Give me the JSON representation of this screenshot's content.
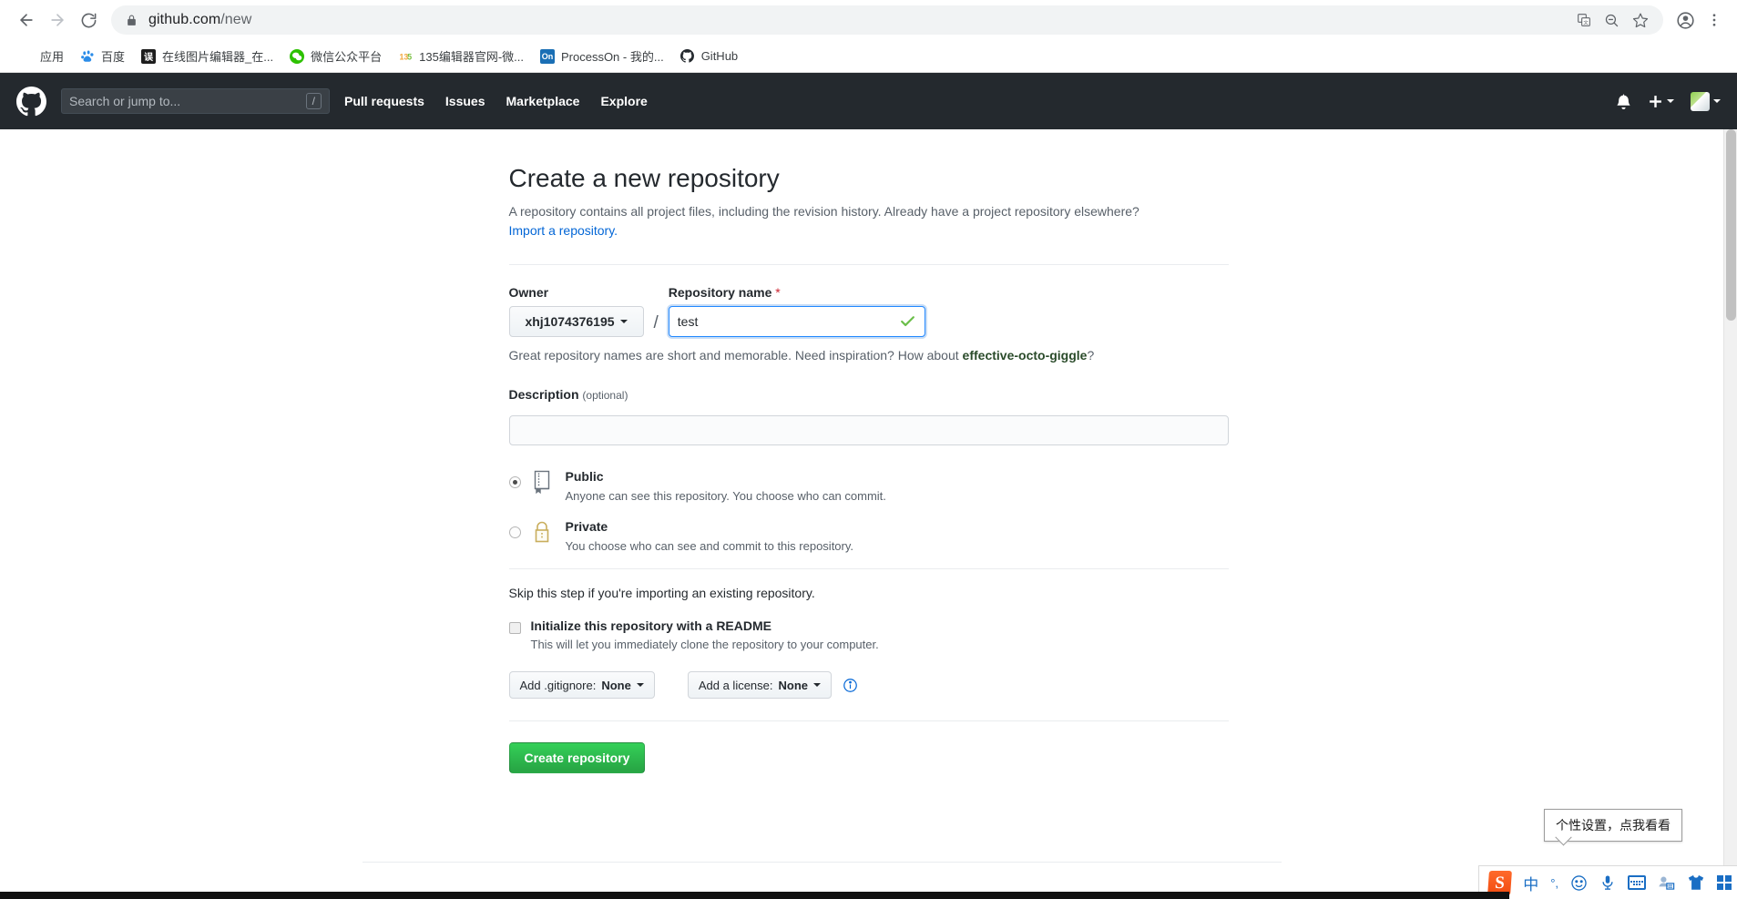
{
  "browser": {
    "back_label": "Back",
    "forward_label": "Forward",
    "reload_label": "Reload",
    "url_host": "github.com",
    "url_path": "/new",
    "lock_icon": "lock-icon",
    "translate_icon": "translate-icon",
    "zoom_out_icon": "zoom-out-icon",
    "bookmark_star_icon": "star-icon",
    "profile_icon": "profile-avatar-icon",
    "menu_icon": "three-dot-menu-icon",
    "bookmarks": [
      {
        "label": "应用",
        "icon": "apps-grid-icon"
      },
      {
        "label": "百度",
        "icon": "baidu-icon"
      },
      {
        "label": "在线图片编辑器_在...",
        "icon": "image-editor-icon"
      },
      {
        "label": "微信公众平台",
        "icon": "wechat-icon"
      },
      {
        "label": "135编辑器官网-微...",
        "icon": "135-editor-icon"
      },
      {
        "label": "ProcessOn - 我的...",
        "icon": "processon-icon",
        "badge": "On"
      },
      {
        "label": "GitHub",
        "icon": "github-icon"
      }
    ]
  },
  "gh_header": {
    "logo_icon": "github-mark-icon",
    "search_placeholder": "Search or jump to...",
    "search_shortcut": "/",
    "nav": [
      {
        "label": "Pull requests"
      },
      {
        "label": "Issues"
      },
      {
        "label": "Marketplace"
      },
      {
        "label": "Explore"
      }
    ],
    "notifications_icon": "bell-icon",
    "create_new_icon": "plus-icon",
    "avatar_icon": "user-avatar-icon",
    "bg_color": "#24292e"
  },
  "main": {
    "title": "Create a new repository",
    "subtitle": "A repository contains all project files, including the revision history. Already have a project repository elsewhere?",
    "import_link": "Import a repository.",
    "owner": {
      "label": "Owner",
      "value": "xhj1074376195"
    },
    "repo_name": {
      "label": "Repository name",
      "required_marker": "*",
      "value": "test",
      "valid_icon": "green-check-icon"
    },
    "separator": "/",
    "hint_prefix": "Great repository names are short and memorable. Need inspiration? How about ",
    "hint_suggestion": "effective-octo-giggle",
    "hint_suffix": "?",
    "description": {
      "label": "Description",
      "optional_label": "(optional)",
      "value": "",
      "placeholder": ""
    },
    "visibility": [
      {
        "id": "public",
        "title": "Public",
        "desc": "Anyone can see this repository. You choose who can commit.",
        "icon": "repo-book-icon",
        "selected": true
      },
      {
        "id": "private",
        "title": "Private",
        "desc": "You choose who can see and commit to this repository.",
        "icon": "lock-icon",
        "selected": false
      }
    ],
    "skip_note": "Skip this step if you're importing an existing repository.",
    "readme": {
      "label": "Initialize this repository with a README",
      "sub": "This will let you immediately clone the repository to your computer.",
      "checked": false
    },
    "gitignore_select": {
      "prefix": "Add .gitignore: ",
      "value": "None"
    },
    "license_select": {
      "prefix": "Add a license: ",
      "value": "None"
    },
    "info_icon": "info-circle-icon",
    "create_button": "Create repository",
    "accent_green": "#28a745",
    "link_blue": "#0366d6"
  },
  "overlay": {
    "tooltip_text": "个性设置，点我看看",
    "ime": {
      "logo": "S",
      "mode_label": "中",
      "punct_label": "°,",
      "emoji_icon": "smiley-icon",
      "mic_icon": "microphone-icon",
      "keyboard_icon": "keyboard-icon",
      "user_icon": "user-card-icon",
      "skin_icon": "tshirt-icon",
      "toolbox_icon": "toolbox-grid-icon"
    }
  }
}
